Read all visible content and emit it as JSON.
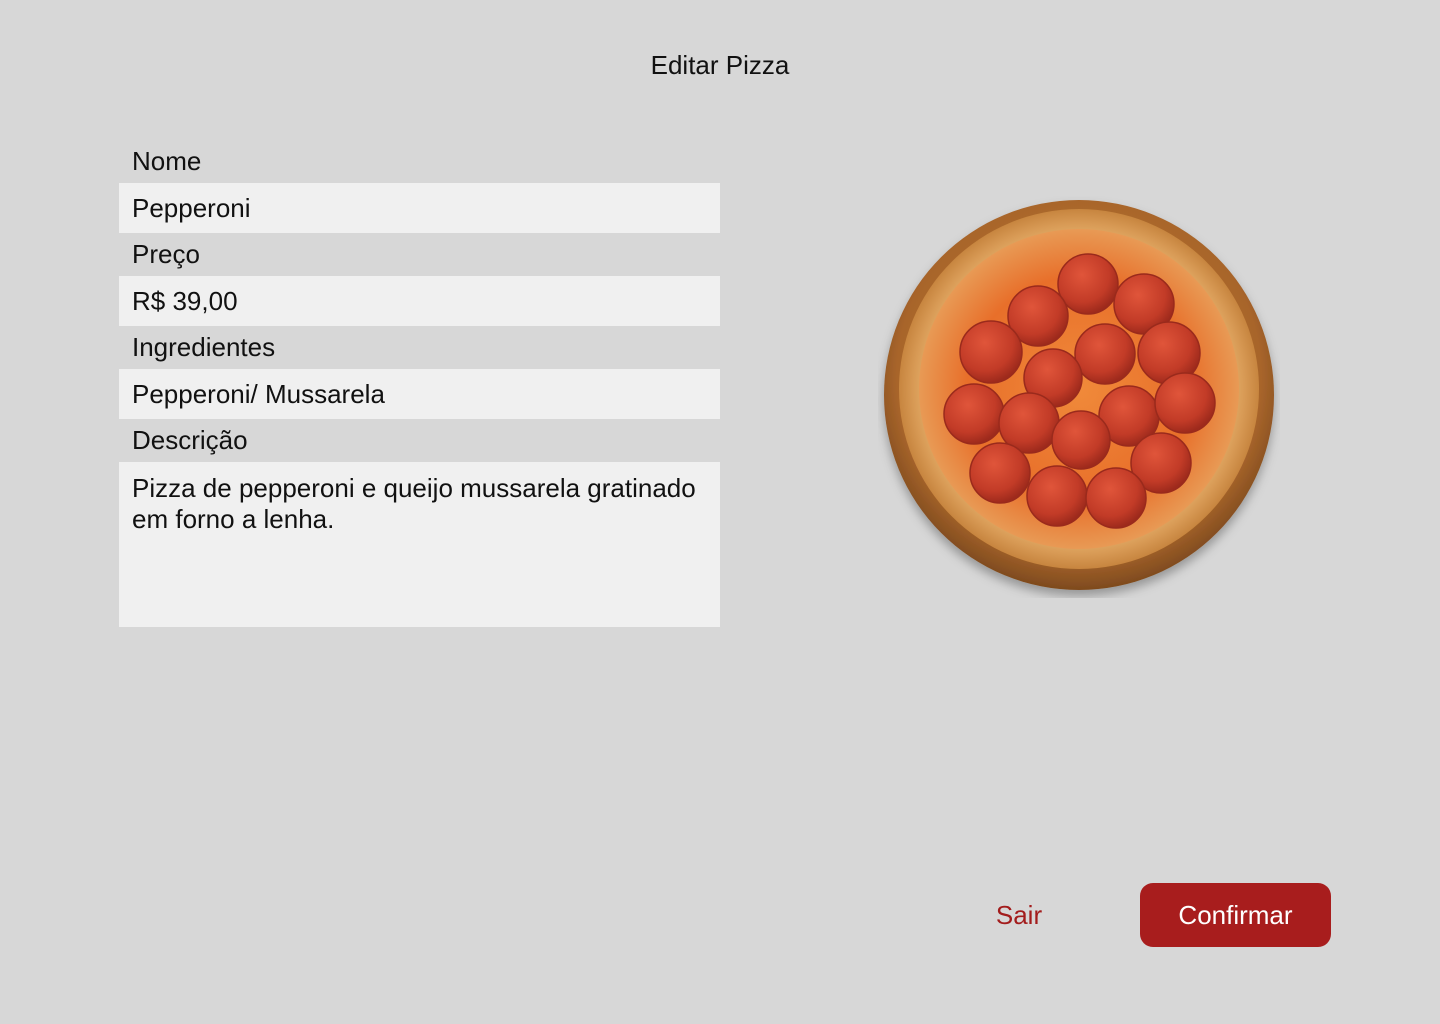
{
  "header": {
    "title": "Editar Pizza"
  },
  "form": {
    "name": {
      "label": "Nome",
      "value": "Pepperoni"
    },
    "price": {
      "label": "Preço",
      "value": "R$ 39,00"
    },
    "ingredients": {
      "label": "Ingredientes",
      "value": "Pepperoni/ Mussarela"
    },
    "description": {
      "label": "Descrição",
      "value": "Pizza de pepperoni e queijo mussarela gratinado em forno a lenha."
    }
  },
  "image": {
    "icon": "pizza-image"
  },
  "actions": {
    "exit_label": "Sair",
    "confirm_label": "Confirmar"
  },
  "colors": {
    "background": "#d7d7d7",
    "input_bg": "#f0f0f0",
    "accent": "#a81d1d"
  }
}
